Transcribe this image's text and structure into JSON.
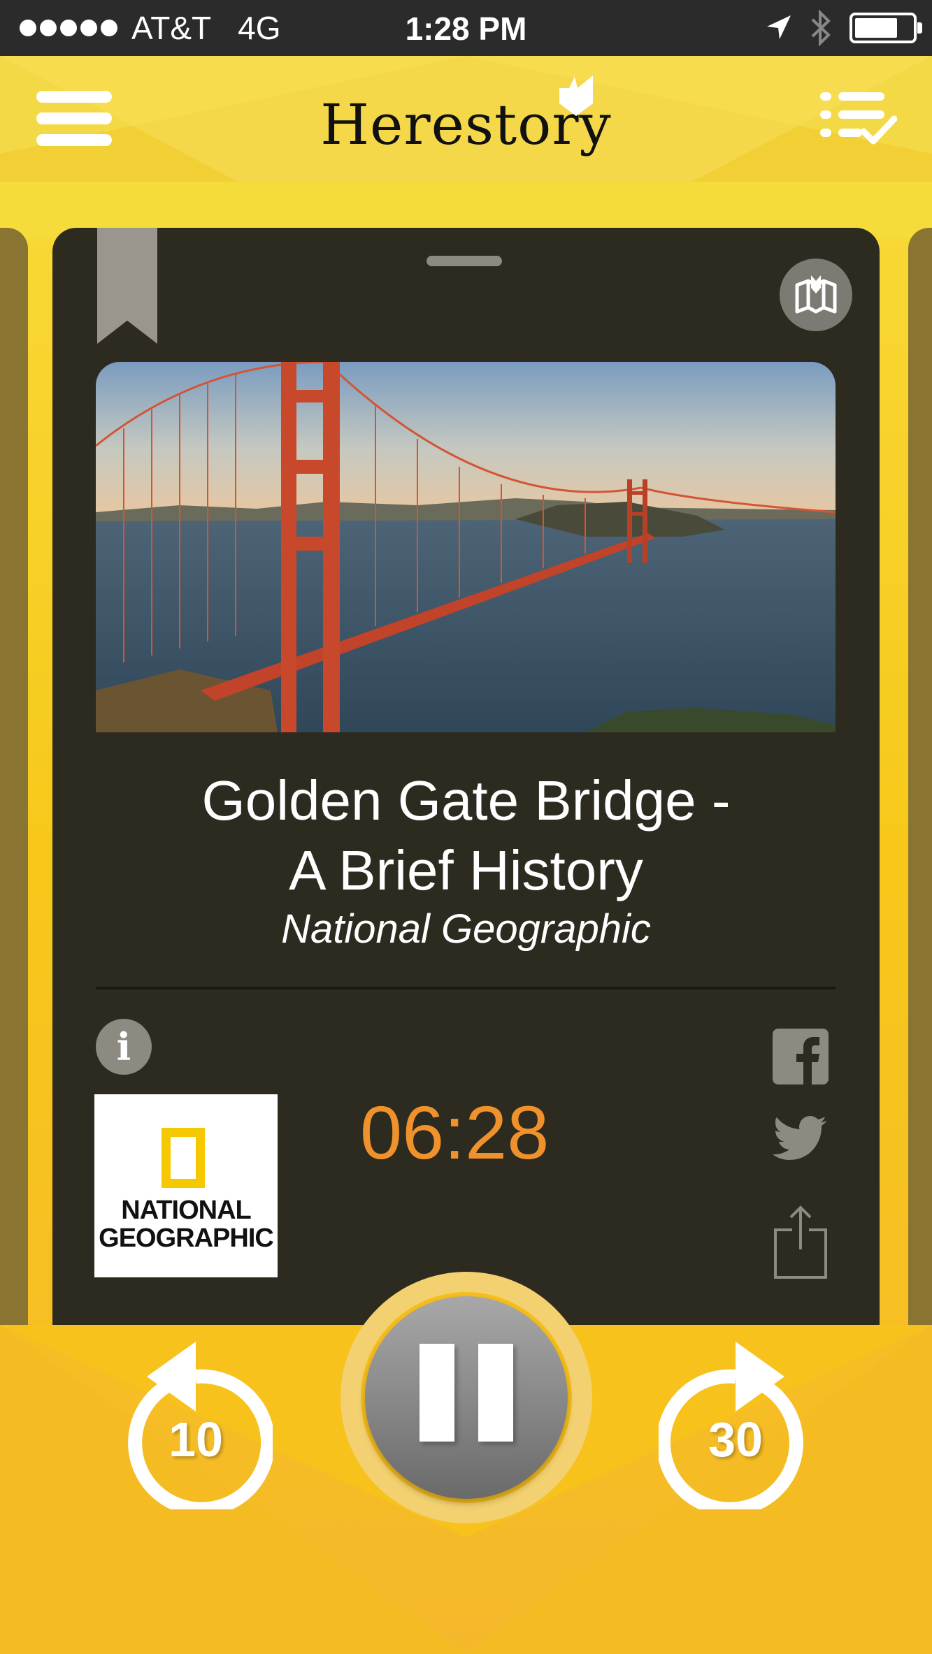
{
  "status_bar": {
    "carrier": "AT&T",
    "network": "4G",
    "time": "1:28 PM",
    "battery_level": 0.75
  },
  "header": {
    "app_name": "Herestory",
    "menu_icon": "hamburger-icon",
    "playlist_icon": "checklist-icon"
  },
  "story": {
    "title_line1": "Golden Gate Bridge -",
    "title_line2": "A Brief History",
    "publisher": "National Geographic",
    "elapsed_time": "06:28",
    "publisher_logo_text_line1": "NATIONAL",
    "publisher_logo_text_line2": "GEOGRAPHIC",
    "info_glyph": "i"
  },
  "controls": {
    "rewind_label": "10",
    "forward_label": "30",
    "pause_icon": "pause-icon"
  },
  "colors": {
    "accent_yellow": "#f5c518",
    "card_bg": "#2d2a20",
    "timer": "#f0922c",
    "icon_gray": "#8d8a82"
  }
}
